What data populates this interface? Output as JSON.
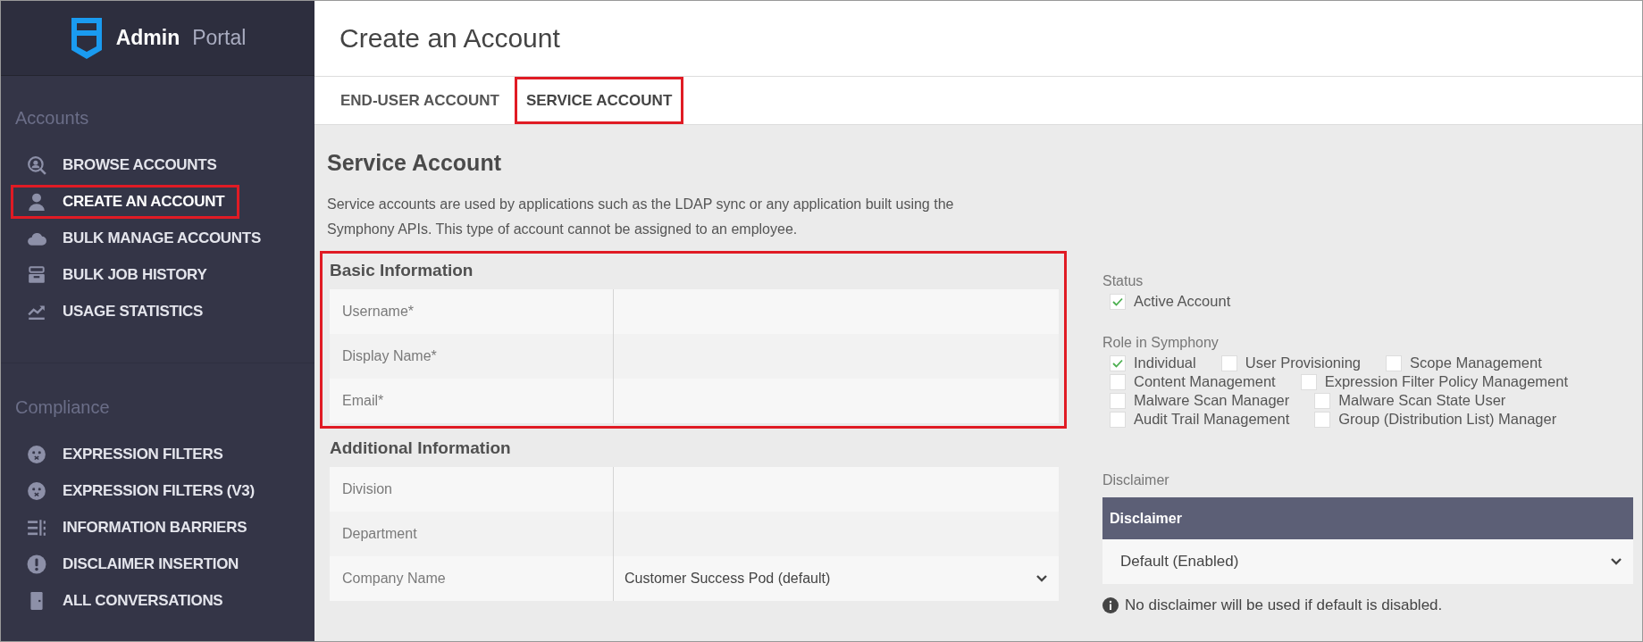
{
  "brand": {
    "name": "Admin",
    "suffix": "Portal"
  },
  "sidebar": {
    "sections": [
      {
        "title": "Accounts",
        "items": [
          {
            "label": "BROWSE ACCOUNTS",
            "selected": false,
            "highlighted": false
          },
          {
            "label": "CREATE AN ACCOUNT",
            "selected": true,
            "highlighted": true
          },
          {
            "label": "BULK MANAGE ACCOUNTS",
            "selected": false,
            "highlighted": false
          },
          {
            "label": "BULK JOB HISTORY",
            "selected": false,
            "highlighted": false
          },
          {
            "label": "USAGE STATISTICS",
            "selected": false,
            "highlighted": false
          }
        ]
      },
      {
        "title": "Compliance",
        "items": [
          {
            "label": "EXPRESSION FILTERS",
            "selected": false,
            "highlighted": false
          },
          {
            "label": "EXPRESSION FILTERS (V3)",
            "selected": false,
            "highlighted": false
          },
          {
            "label": "INFORMATION BARRIERS",
            "selected": false,
            "highlighted": false
          },
          {
            "label": "DISCLAIMER INSERTION",
            "selected": false,
            "highlighted": false
          },
          {
            "label": "ALL CONVERSATIONS",
            "selected": false,
            "highlighted": false
          }
        ]
      }
    ]
  },
  "page_title": "Create an Account",
  "tabs": [
    {
      "label": "END-USER ACCOUNT",
      "selected": false,
      "highlighted": false
    },
    {
      "label": "SERVICE ACCOUNT",
      "selected": true,
      "highlighted": true
    }
  ],
  "heading": "Service Account",
  "description": "Service accounts are used by applications such as the LDAP sync or any application built using the Symphony APIs. This type of account cannot be assigned to an employee.",
  "form_sections": [
    {
      "title": "Basic Information",
      "highlighted": true,
      "fields": [
        {
          "label": "Username*",
          "kind": "text"
        },
        {
          "label": "Display Name*",
          "kind": "text"
        },
        {
          "label": "Email*",
          "kind": "text"
        }
      ]
    },
    {
      "title": "Additional Information",
      "highlighted": false,
      "fields": [
        {
          "label": "Division",
          "kind": "text"
        },
        {
          "label": "Department",
          "kind": "text"
        },
        {
          "label": "Company Name",
          "kind": "select",
          "value": "Customer Success Pod (default)"
        }
      ]
    }
  ],
  "status": {
    "label": "Status",
    "options": [
      {
        "label": "Active Account",
        "checked": true
      }
    ]
  },
  "roles": {
    "label": "Role in Symphony",
    "rows": [
      [
        {
          "label": "Individual",
          "checked": true
        },
        {
          "label": "User Provisioning",
          "checked": false
        },
        {
          "label": "Scope Management",
          "checked": false
        }
      ],
      [
        {
          "label": "Content Management",
          "checked": false
        },
        {
          "label": "Expression Filter Policy Management",
          "checked": false
        }
      ],
      [
        {
          "label": "Malware Scan Manager",
          "checked": false
        },
        {
          "label": "Malware Scan State User",
          "checked": false
        }
      ],
      [
        {
          "label": "Audit Trail Management",
          "checked": false
        },
        {
          "label": "Group (Distribution List) Manager",
          "checked": false
        }
      ]
    ]
  },
  "disclaimer": {
    "label": "Disclaimer",
    "header": "Disclaimer",
    "value": "Default (Enabled)",
    "note": "No disclaimer will be used if default is disabled."
  }
}
